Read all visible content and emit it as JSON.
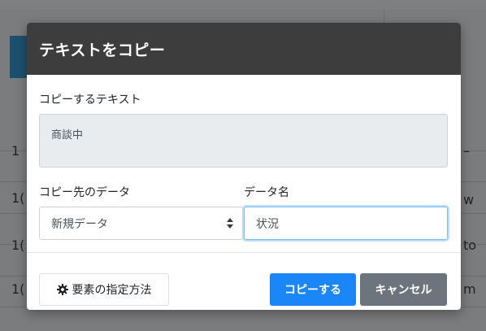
{
  "background": {
    "row_fragments_left": [
      "1",
      "1(",
      "1(",
      "1("
    ],
    "row_fragments_right": [
      "–",
      "w",
      "to",
      "m"
    ]
  },
  "modal": {
    "title": "テキストをコピー",
    "copy_text_label": "コピーするテキスト",
    "copy_text_value": "商談中",
    "destination_label": "コピー先のデータ",
    "destination_selected": "新規データ",
    "data_name_label": "データ名",
    "data_name_value": "状況",
    "method_button_label": "要素の指定方法",
    "copy_button_label": "コピーする",
    "cancel_button_label": "キャンセル"
  },
  "colors": {
    "header_bg": "#3d3d3d",
    "primary": "#1a86f7",
    "secondary": "#6c757d"
  },
  "icons": {
    "method_button_icon": "gear-icon",
    "select_icon": "sort-arrows-icon"
  }
}
